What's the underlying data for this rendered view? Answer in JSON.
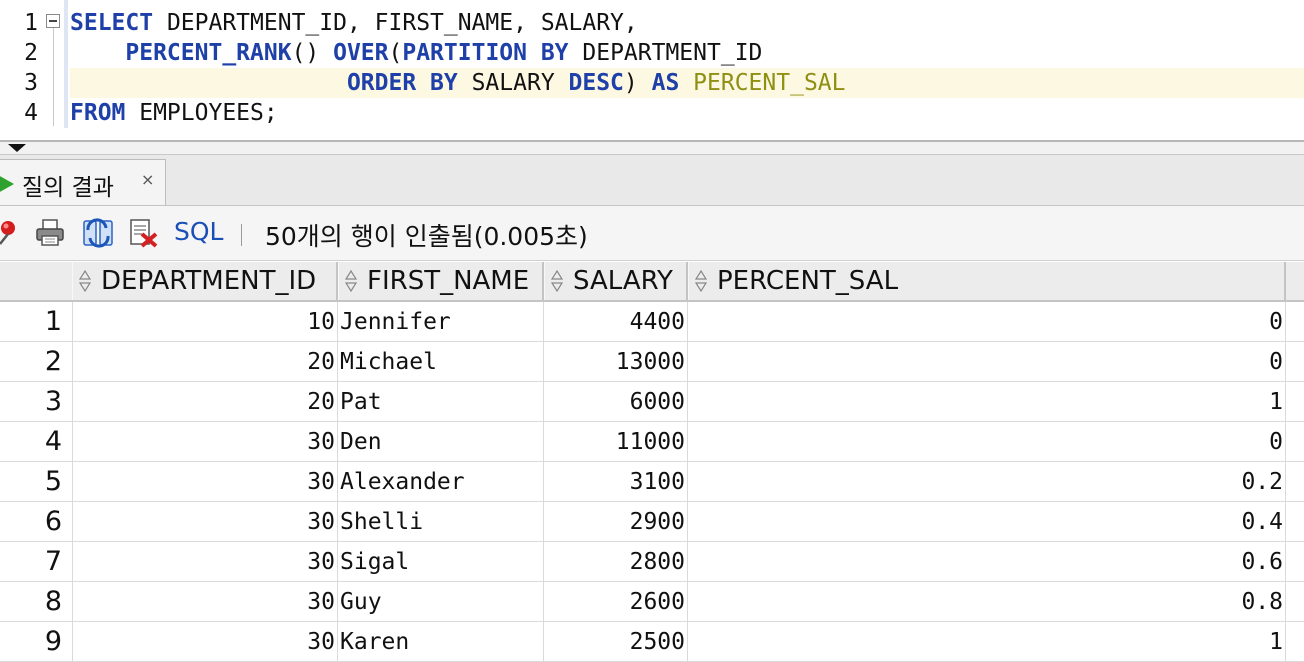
{
  "editor": {
    "line_numbers": [
      "1",
      "2",
      "3",
      "4"
    ],
    "lines": [
      [
        {
          "t": "SELECT",
          "k": "kw"
        },
        {
          "t": " DEPARTMENT_ID, FIRST_NAME, SALARY,",
          "k": ""
        }
      ],
      [
        {
          "t": "    ",
          "k": ""
        },
        {
          "t": "PERCENT_RANK",
          "k": "kw"
        },
        {
          "t": "() ",
          "k": ""
        },
        {
          "t": "OVER",
          "k": "kw"
        },
        {
          "t": "(",
          "k": ""
        },
        {
          "t": "PARTITION BY",
          "k": "kw"
        },
        {
          "t": " DEPARTMENT_ID",
          "k": ""
        }
      ],
      [
        {
          "t": "                    ",
          "k": ""
        },
        {
          "t": "ORDER BY",
          "k": "kw"
        },
        {
          "t": " SALARY ",
          "k": ""
        },
        {
          "t": "DESC",
          "k": "kw"
        },
        {
          "t": ") ",
          "k": ""
        },
        {
          "t": "AS",
          "k": "kw"
        },
        {
          "t": " ",
          "k": ""
        },
        {
          "t": "PERCENT_SAL",
          "k": "al"
        }
      ],
      [
        {
          "t": "FROM",
          "k": "kw"
        },
        {
          "t": " EMPLOYEES;",
          "k": ""
        }
      ]
    ],
    "current_line": 3
  },
  "results_tab": {
    "label": "질의 결과",
    "close_glyph": "×"
  },
  "toolbar": {
    "pin_icon": "pin-icon",
    "print_icon": "print-icon",
    "refresh_icon": "refresh-icon",
    "export_icon": "export-cancel-icon",
    "sql_label": "SQL",
    "status": "50개의 행이 인출됨(0.005초)"
  },
  "grid": {
    "columns": [
      "DEPARTMENT_ID",
      "FIRST_NAME",
      "SALARY",
      "PERCENT_SAL"
    ],
    "rows": [
      {
        "n": "1",
        "dept": "10",
        "name": "Jennifer",
        "salary": "4400",
        "pct": "0"
      },
      {
        "n": "2",
        "dept": "20",
        "name": "Michael",
        "salary": "13000",
        "pct": "0"
      },
      {
        "n": "3",
        "dept": "20",
        "name": "Pat",
        "salary": "6000",
        "pct": "1"
      },
      {
        "n": "4",
        "dept": "30",
        "name": "Den",
        "salary": "11000",
        "pct": "0"
      },
      {
        "n": "5",
        "dept": "30",
        "name": "Alexander",
        "salary": "3100",
        "pct": "0.2"
      },
      {
        "n": "6",
        "dept": "30",
        "name": "Shelli",
        "salary": "2900",
        "pct": "0.4"
      },
      {
        "n": "7",
        "dept": "30",
        "name": "Sigal",
        "salary": "2800",
        "pct": "0.6"
      },
      {
        "n": "8",
        "dept": "30",
        "name": "Guy",
        "salary": "2600",
        "pct": "0.8"
      },
      {
        "n": "9",
        "dept": "30",
        "name": "Karen",
        "salary": "2500",
        "pct": "1"
      }
    ]
  },
  "colors": {
    "keyword": "#1e40a8",
    "alias": "#8f8f12",
    "sql_link": "#1a4fb8",
    "run_icon": "#2ea12e",
    "current_line_bg": "#fdf8e2"
  }
}
